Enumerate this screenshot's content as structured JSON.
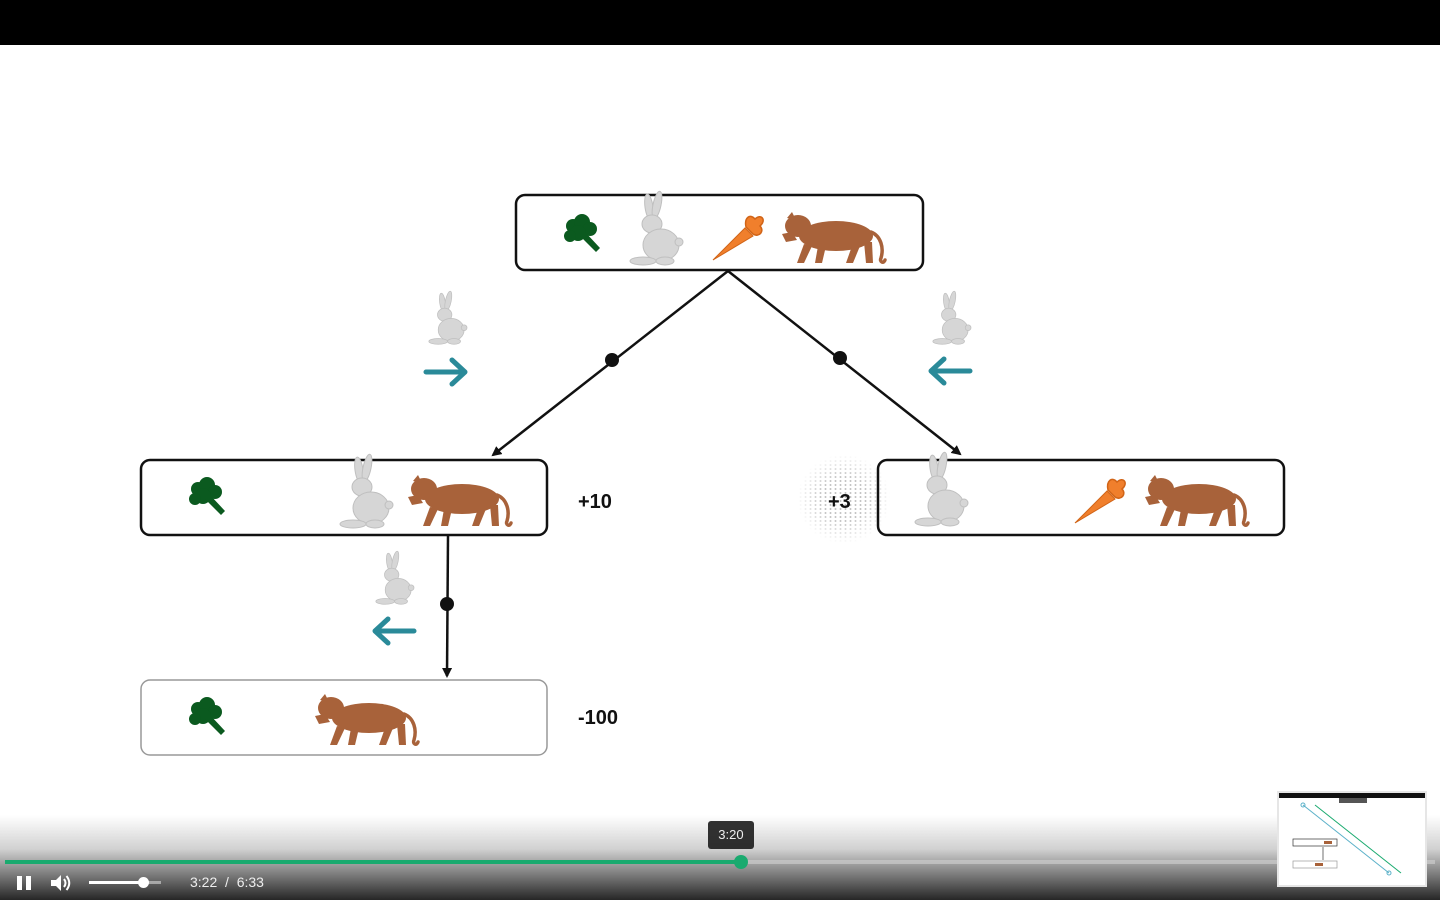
{
  "diagram": {
    "scores": {
      "left": "+10",
      "right": "+3",
      "bottom": "-100"
    }
  },
  "player": {
    "state": "playing",
    "current_time": "3:22",
    "separator": "/",
    "duration": "6:33",
    "hover_time": "3:20",
    "progress": 0.515,
    "hover_position": 0.51,
    "volume": 0.75
  },
  "icons": {
    "play_pause": "pause-icon",
    "volume": "volume-icon",
    "broccoli": "broccoli-icon",
    "rabbit": "rabbit-icon",
    "carrot": "carrot-icon",
    "tiger": "tiger-icon",
    "arrow_right": "arrow-right-icon",
    "arrow_left": "arrow-left-icon"
  },
  "colors": {
    "accent": "#1aaa6f",
    "broccoli": "#0b5a1f",
    "rabbit": "#d6d6d6",
    "carrot": "#f07f2c",
    "tiger": "#a8623a",
    "arrow": "#2a8a99"
  }
}
